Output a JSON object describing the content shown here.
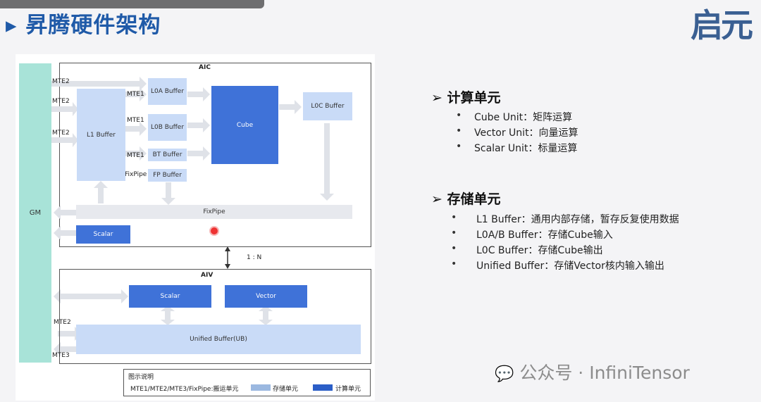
{
  "slide_title": "昇腾硬件架构",
  "logo_text": "启元",
  "diagram": {
    "gm": "GM",
    "aic_title": "AIC",
    "aiv_title": "AIV",
    "ratio": "1 : N",
    "mte2_a": "MTE2",
    "mte2_b": "MTE2",
    "mte2_c": "MTE2",
    "mte1_a": "MTE1",
    "mte1_b": "MTE1",
    "mte1_c": "MTE1",
    "fixpipe_port": "FixPipe",
    "l1_buffer": "L1 Buffer",
    "l0a_buffer": "L0A Buffer",
    "l0b_buffer": "L0B Buffer",
    "bt_buffer": "BT Buffer",
    "fp_buffer": "FP Buffer",
    "cube": "Cube",
    "l0c_buffer": "L0C Buffer",
    "fixpipe_bar": "FixPipe",
    "aic_scalar": "Scalar",
    "aiv_scalar": "Scalar",
    "vector": "Vector",
    "ub": "Unified Buffer(UB)",
    "aiv_mte2": "MTE2",
    "aiv_mte3": "MTE3",
    "legend_title": "图示说明",
    "legend_move": "MTE1/MTE2/MTE3/FixPipe:搬运单元",
    "legend_storage": "存储单元",
    "legend_compute": "计算单元"
  },
  "right_panel": {
    "compute_head": "计算单元",
    "compute_items": [
      "Cube Unit：矩阵运算",
      "Vector Unit：向量运算",
      "Scalar Unit：标量运算"
    ],
    "storage_head": "存储单元",
    "storage_items": [
      "L1 Buffer：通用内部存储，暂存反复使用数据",
      "L0A/B Buffer：存储Cube输入",
      "L0C Buffer：存储Cube输出",
      "Unified Buffer：存储Vector核内输入输出"
    ]
  },
  "watermark": "公众号 · InfiniTensor",
  "colors": {
    "storage": "#c9dbf7",
    "compute": "#3f72d8",
    "gm": "#a8e3d8",
    "title": "#1f5aa8"
  }
}
